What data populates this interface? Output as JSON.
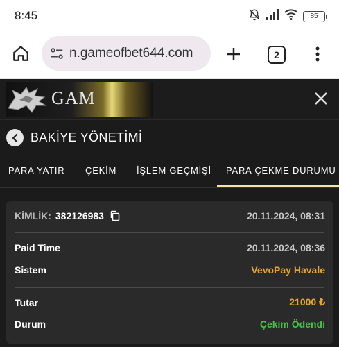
{
  "status_bar": {
    "time": "8:45",
    "battery": "85",
    "icons": [
      "bell-muted-icon",
      "signal-icon",
      "wifi-icon",
      "battery-icon"
    ]
  },
  "browser": {
    "url": "n.gameofbet644.com",
    "tab_count": "2",
    "icons": [
      "home-icon",
      "site-settings-icon",
      "plus-icon",
      "tabs-icon",
      "more-vert-icon"
    ]
  },
  "site": {
    "logo_text": "GAM",
    "close_icon": "close-icon"
  },
  "panel": {
    "title": "BAKİYE YÖNETİMİ",
    "tabs": [
      {
        "label": "PARA YATIR"
      },
      {
        "label": "ÇEKİM"
      },
      {
        "label": "İŞLEM GEÇMİŞİ"
      },
      {
        "label": "PARA ÇEKME DURUMU",
        "active": true
      }
    ]
  },
  "card": {
    "id_label": "KİMLİK:",
    "id_value": "382126983",
    "created": "20.11.2024, 08:31",
    "paid_time_label": "Paid Time",
    "paid_time_value": "20.11.2024, 08:36",
    "system_label": "Sistem",
    "system_value": "VevoPay Havale",
    "amount_label": "Tutar",
    "amount_value": "21000 ₺",
    "status_label": "Durum",
    "status_value": "Çekim Ödendi"
  },
  "colors": {
    "accent_gold": "#e4a630",
    "status_green": "#48c344",
    "tab_underline": "#f2e3a8"
  }
}
